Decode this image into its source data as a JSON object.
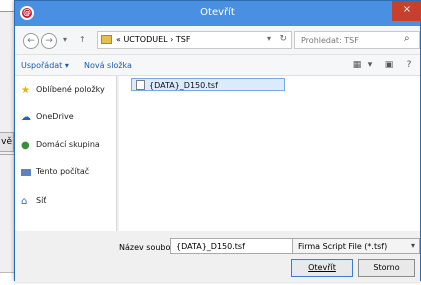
{
  "dialog": {
    "title": "Otevřít",
    "close_label": "×",
    "address_path": "« UCTODUEL › TSF",
    "search_placeholder": "Prohledat: TSF",
    "organize": "Uspořádat ▾",
    "new_folder": "Nová složka",
    "sidebar": [
      {
        "label": "Oblíbené položky"
      },
      {
        "label": "OneDrive"
      },
      {
        "label": "Domácí skupina"
      },
      {
        "label": "Tento počítač"
      },
      {
        "label": "Síť"
      }
    ],
    "file_name": "{DATA}_D150.tsf",
    "file_name_label": "Název souboru:",
    "file_name_value": "{DATA}_D150.tsf",
    "filter_value": "Firma Script File (*.tsf)",
    "open_button": "Otevřít",
    "cancel_button": "Storno"
  },
  "background": {
    "partial_button": "vě"
  },
  "icons": {
    "app": "app-icon",
    "back": "back-icon",
    "forward": "forward-icon",
    "up": "up-icon",
    "folder": "folder-icon",
    "refresh": "refresh-icon",
    "search": "search-icon",
    "view": "view-icon",
    "preview": "preview-pane-icon",
    "help": "help-icon",
    "file": "file-icon"
  },
  "colors": {
    "title_bar": "#4a90e2",
    "selection": "#dcebfc",
    "close": "#c7402e"
  }
}
